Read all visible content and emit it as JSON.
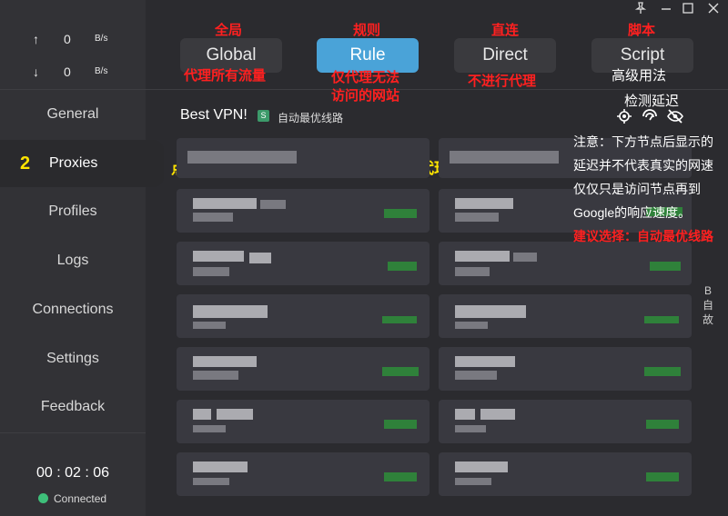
{
  "window": {
    "controls": [
      "📌",
      "—",
      "☐",
      "✕"
    ]
  },
  "sidebar": {
    "upload": {
      "arrow": "↑",
      "value": "0",
      "unit": "B/s"
    },
    "download": {
      "arrow": "↓",
      "value": "0",
      "unit": "B/s"
    },
    "nav": [
      "General",
      "Proxies",
      "Profiles",
      "Logs",
      "Connections",
      "Settings",
      "Feedback"
    ],
    "active_index_label": "2",
    "timer": "00 : 02 : 06",
    "status": "Connected",
    "status_color": "#3ebf7a"
  },
  "modes": {
    "buttons": [
      "Global",
      "Rule",
      "Direct",
      "Script"
    ],
    "active": "Rule",
    "labels_top": [
      "全局",
      "规则",
      "直连",
      "脚本"
    ],
    "desc": {
      "global": "代理所有流量",
      "rule_1": "仅代理无法",
      "rule_2": "访问的网站",
      "direct": "不进行代理",
      "script": "高级用法"
    }
  },
  "proxies": {
    "group_name": "Best VPN!",
    "tag": "S",
    "selected": "自动最优线路",
    "hint": "点击下方代理节点名称选择你需要的代理节点",
    "test_label": "检测延迟"
  },
  "notes": {
    "line1": "注意：下方节点后显示的",
    "line2": "延迟并不代表真实的网速",
    "line3": "仅仅只是访问节点再到",
    "line4": "Google的响应速度。",
    "suggest": "建议选择：自动最优线路"
  },
  "right_strip": [
    "B",
    "自",
    "故"
  ],
  "colors": {
    "accent": "#4aa3d8",
    "annotation_red": "#ff2020",
    "annotation_yellow": "#ffe400"
  }
}
